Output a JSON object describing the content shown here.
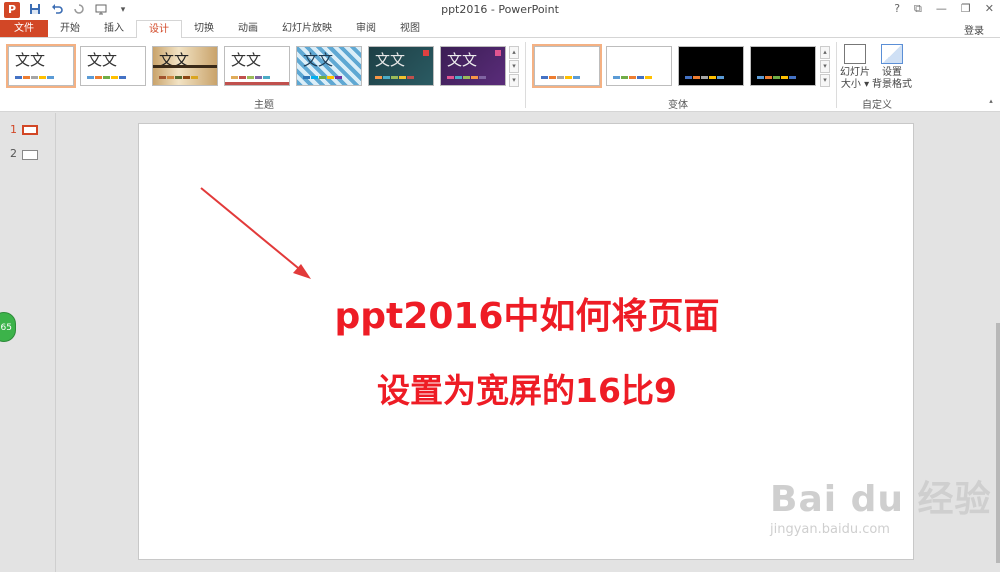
{
  "titlebar": {
    "app_logo": "P",
    "title": "ppt2016 - PowerPoint",
    "qat_icons": [
      "save-icon",
      "undo-icon",
      "redo-icon",
      "start-slideshow-icon",
      "customize-qat-icon"
    ],
    "window_controls": [
      "?",
      "⧉",
      "—",
      "❐",
      "✕"
    ]
  },
  "tabs": [
    "文件",
    "开始",
    "插入",
    "设计",
    "切换",
    "动画",
    "幻灯片放映",
    "审阅",
    "视图"
  ],
  "active_tab": "设计",
  "login": "登录",
  "ribbon": {
    "themes_label": "主题",
    "variants_label": "变体",
    "customize_label": "自定义",
    "theme_sample": "文文",
    "slide_size_button": [
      "幻灯片",
      "大小 ▾"
    ],
    "format_background_button": [
      "设置",
      "背景格式"
    ]
  },
  "colors": {
    "brand": "#d24726",
    "slide_text": "#ee1c25",
    "arrow": "#e23a3a"
  },
  "thumbnails": [
    {
      "num": "1",
      "active": true
    },
    {
      "num": "2",
      "active": false
    }
  ],
  "side_badge": "65",
  "slide": {
    "line1": "ppt2016中如何将页面",
    "line2": "设置为宽屏的16比9"
  },
  "watermark": {
    "brand": "Bai du 经验",
    "url": "jingyan.baidu.com"
  }
}
